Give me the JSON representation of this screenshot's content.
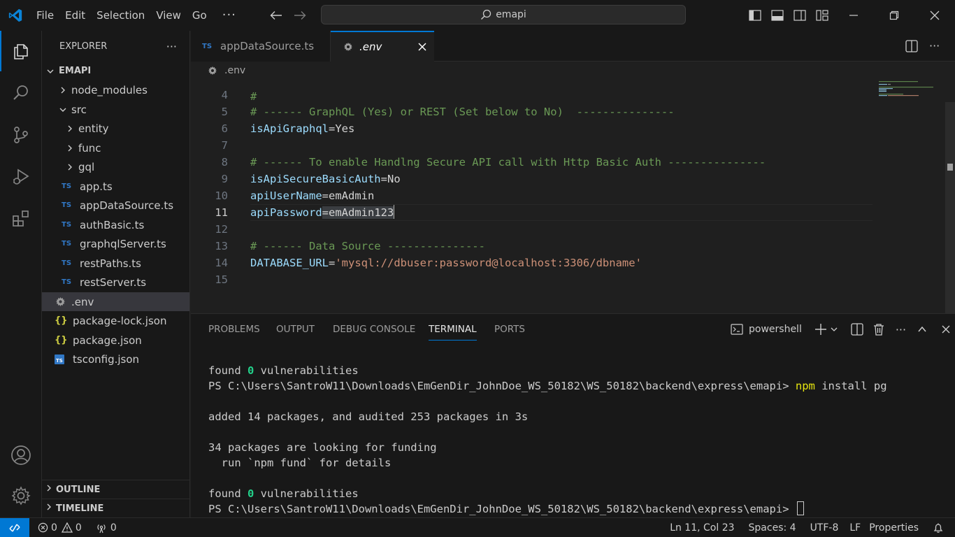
{
  "titlebar": {
    "menu": [
      "File",
      "Edit",
      "Selection",
      "View",
      "Go"
    ],
    "more": "···",
    "search_text": "emapi"
  },
  "explorer": {
    "header": "EXPLORER",
    "more": "···",
    "root": "EMAPI",
    "items": [
      {
        "label": "node_modules",
        "kind": "folder",
        "expanded": false
      },
      {
        "label": "src",
        "kind": "folder",
        "expanded": true
      },
      {
        "label": "entity",
        "kind": "folder",
        "expanded": false
      },
      {
        "label": "func",
        "kind": "folder",
        "expanded": false
      },
      {
        "label": "gql",
        "kind": "folder",
        "expanded": false
      },
      {
        "label": "app.ts",
        "kind": "ts"
      },
      {
        "label": "appDataSource.ts",
        "kind": "ts"
      },
      {
        "label": "authBasic.ts",
        "kind": "ts"
      },
      {
        "label": "graphqlServer.ts",
        "kind": "ts"
      },
      {
        "label": "restPaths.ts",
        "kind": "ts"
      },
      {
        "label": "restServer.ts",
        "kind": "ts"
      },
      {
        "label": ".env",
        "kind": "env",
        "selected": true
      },
      {
        "label": "package-lock.json",
        "kind": "json"
      },
      {
        "label": "package.json",
        "kind": "json"
      },
      {
        "label": "tsconfig.json",
        "kind": "tsconfig"
      }
    ],
    "outline": "OUTLINE",
    "timeline": "TIMELINE",
    "ts_badge": "TS",
    "json_badge": "{}"
  },
  "tabs": [
    {
      "label": "appDataSource.ts",
      "badge": "TS",
      "active": false
    },
    {
      "label": ".env",
      "active": true
    }
  ],
  "breadcrumb": ".env",
  "editor": {
    "partial_top": "#",
    "lines": [
      {
        "num": "4",
        "parts": []
      },
      {
        "num": "5",
        "parts": [
          {
            "t": "# ------ GraphQL (Yes) or REST (Set below to No)  ---------------",
            "c": "c-comment"
          }
        ]
      },
      {
        "num": "6",
        "parts": [
          {
            "t": "isApiGraphql",
            "c": "c-key"
          },
          {
            "t": "=",
            "c": "c-op"
          },
          {
            "t": "Yes",
            "c": "c-val"
          }
        ]
      },
      {
        "num": "7",
        "parts": []
      },
      {
        "num": "8",
        "parts": [
          {
            "t": "# ------ To enable Handlng Secure API call with Http Basic Auth ---------------",
            "c": "c-comment"
          }
        ]
      },
      {
        "num": "9",
        "parts": [
          {
            "t": "isApiSecureBasicAuth",
            "c": "c-key"
          },
          {
            "t": "=",
            "c": "c-op"
          },
          {
            "t": "No",
            "c": "c-val"
          }
        ]
      },
      {
        "num": "10",
        "parts": [
          {
            "t": "apiUserName",
            "c": "c-key"
          },
          {
            "t": "=",
            "c": "c-op"
          },
          {
            "t": "emAdmin",
            "c": "c-val"
          }
        ]
      },
      {
        "num": "11",
        "current": true,
        "parts": [
          {
            "t": "apiPassword",
            "c": "c-key"
          },
          {
            "t": "=",
            "c": "c-op sel-hl"
          },
          {
            "t": "emAdmin123",
            "c": "c-val sel-hl"
          }
        ]
      },
      {
        "num": "12",
        "parts": []
      },
      {
        "num": "13",
        "parts": [
          {
            "t": "# ------ Data Source ---------------",
            "c": "c-comment"
          }
        ]
      },
      {
        "num": "14",
        "parts": [
          {
            "t": "DATABASE_URL",
            "c": "c-key"
          },
          {
            "t": "=",
            "c": "c-op"
          },
          {
            "t": "'mysql://dbuser:password@localhost:3306/dbname'",
            "c": "c-str"
          }
        ]
      },
      {
        "num": "15",
        "parts": []
      }
    ]
  },
  "panel": {
    "tabs": [
      "PROBLEMS",
      "OUTPUT",
      "DEBUG CONSOLE",
      "TERMINAL",
      "PORTS"
    ],
    "active_tab": "TERMINAL",
    "shell": "powershell",
    "more": "···",
    "terminal": {
      "found1_a": "found ",
      "found1_b": "0",
      "found1_c": " vulnerabilities",
      "prompt1": "PS C:\\Users\\SantroW11\\Downloads\\EmGenDir_JohnDoe_WS_50182\\WS_50182\\backend\\express\\emapi> ",
      "cmd1_a": "npm",
      "cmd1_b": " install pg",
      "added": "added 14 packages, and audited 253 packages in 3s",
      "funding": "34 packages are looking for funding",
      "fund_hint": "  run `npm fund` for details",
      "found2_a": "found ",
      "found2_b": "0",
      "found2_c": " vulnerabilities",
      "prompt2": "PS C:\\Users\\SantroW11\\Downloads\\EmGenDir_JohnDoe_WS_50182\\WS_50182\\backend\\express\\emapi> "
    }
  },
  "statusbar": {
    "errors": "0",
    "warnings": "0",
    "ports": "0",
    "position": "Ln 11, Col 23",
    "spaces": "Spaces: 4",
    "encoding": "UTF-8",
    "eol": "LF",
    "language": "Properties"
  },
  "colors": {
    "accent": "#0078d4",
    "ts": "#3178c6",
    "json": "#cbcb41",
    "comment": "#6a9955",
    "key": "#9cdcfe",
    "string": "#ce9178"
  }
}
